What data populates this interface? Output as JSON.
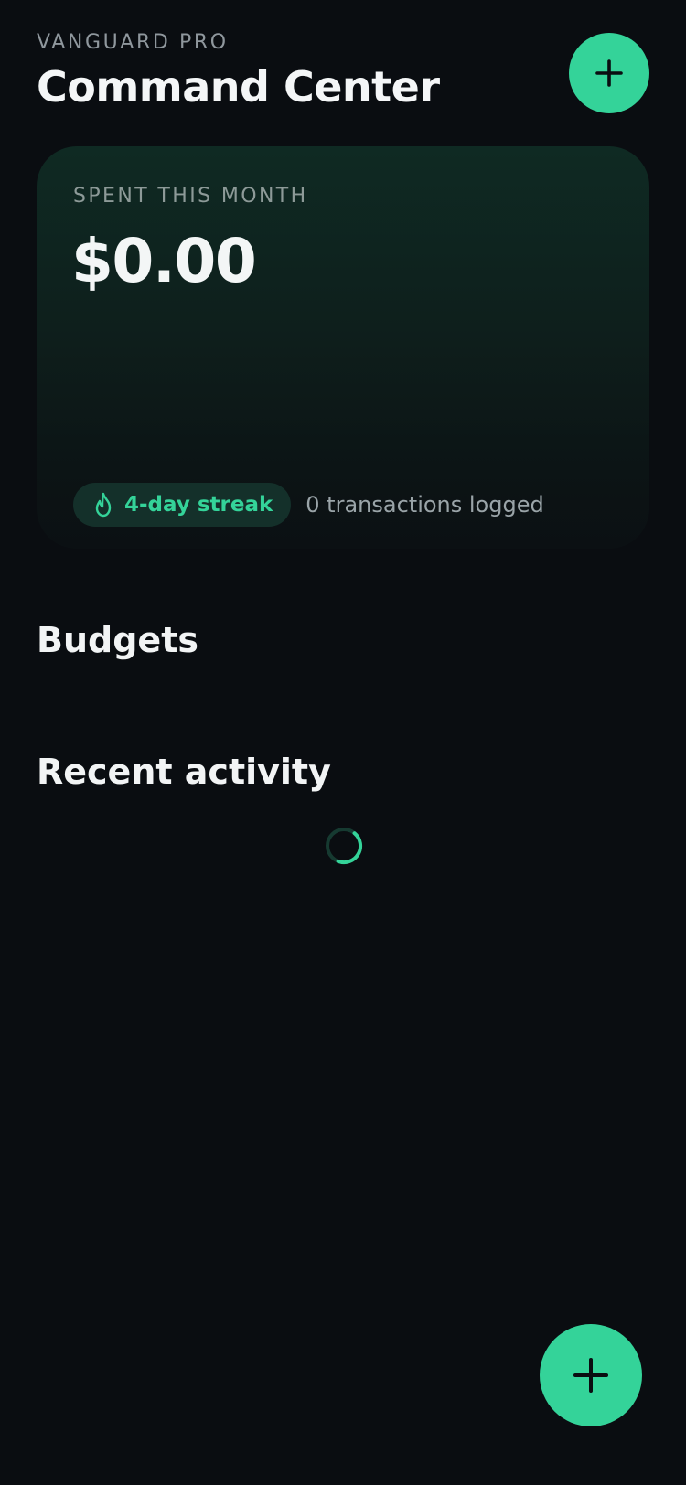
{
  "header": {
    "app_name": "VANGUARD PRO",
    "title": "Command Center",
    "add_icon": "plus-icon"
  },
  "summary": {
    "label": "SPENT THIS MONTH",
    "amount": "$0.00",
    "streak_icon": "flame-icon",
    "streak": "4-day streak",
    "transactions": "0 transactions logged"
  },
  "sections": {
    "budgets": "Budgets",
    "recent_activity": "Recent activity"
  },
  "fab": {
    "icon": "plus-icon"
  },
  "colors": {
    "background": "#0a0d11",
    "accent": "#34d399",
    "chip_background": "#14302a",
    "muted_text": "#8f979d"
  }
}
